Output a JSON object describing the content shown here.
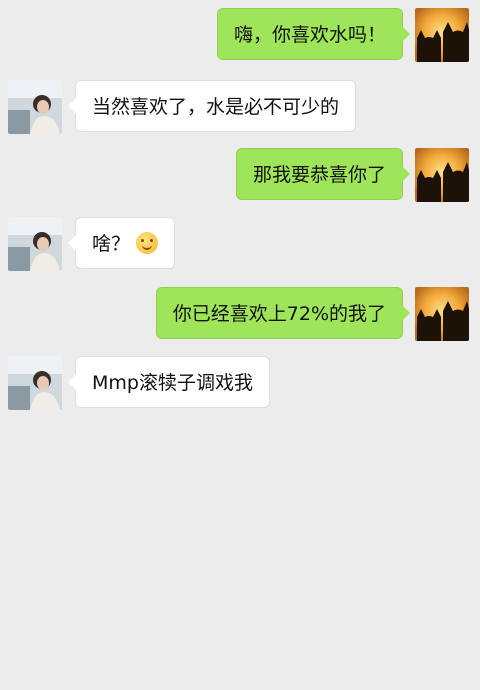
{
  "chat": {
    "messages": [
      {
        "sender": "me",
        "text": "嗨，你喜欢水吗！"
      },
      {
        "sender": "them",
        "text": "当然喜欢了，水是必不可少的"
      },
      {
        "sender": "me",
        "text": "那我要恭喜你了"
      },
      {
        "sender": "them",
        "text": "啥？",
        "emoji": "smiling-face-emoji"
      },
      {
        "sender": "me",
        "text": "你已经喜欢上72%的我了"
      },
      {
        "sender": "them",
        "text": "Mmp滚犊子调戏我"
      }
    ]
  },
  "colors": {
    "background": "#ececec",
    "my_bubble": "#9fe55a",
    "their_bubble": "#ffffff"
  },
  "icons": {
    "my_avatar": "cats-sunset-avatar",
    "their_avatar": "girl-photo-avatar"
  }
}
